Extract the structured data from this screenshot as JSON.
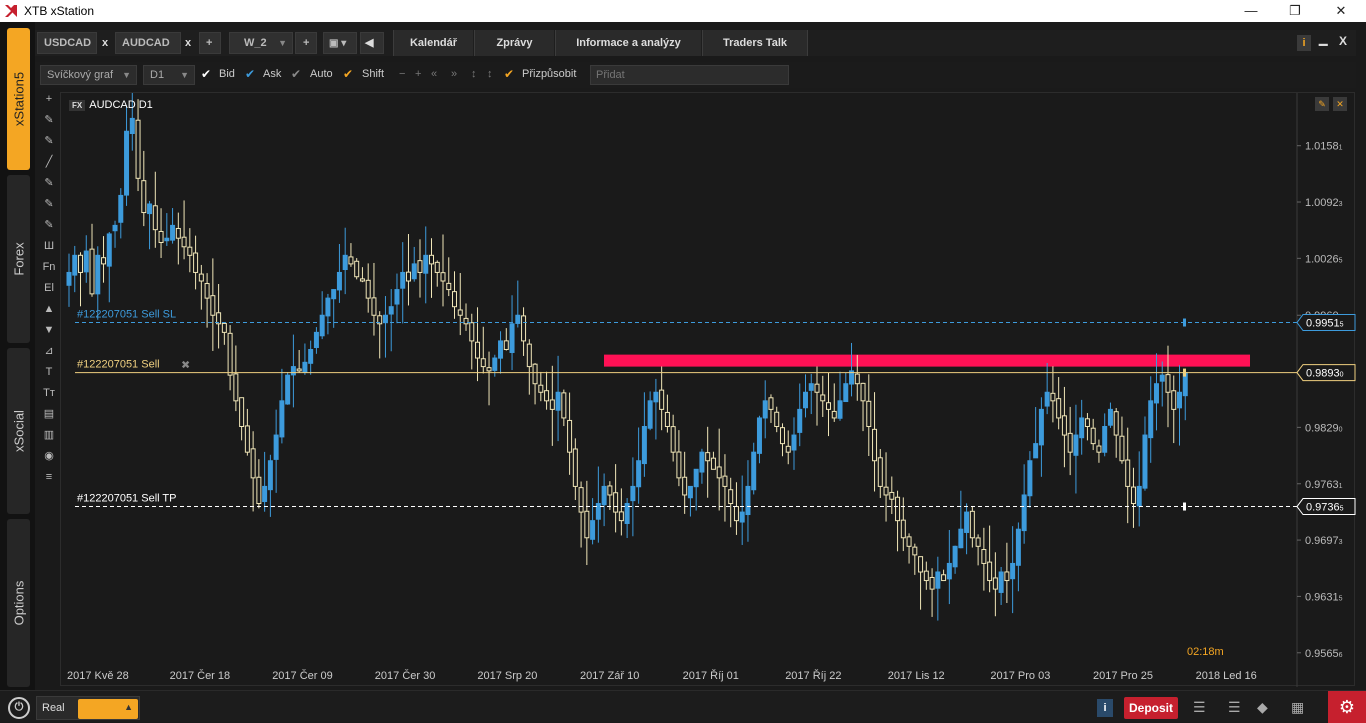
{
  "window": {
    "title": "XTB xStation",
    "minimize": "—",
    "maximize": "❐",
    "close": "✕"
  },
  "sidebar": {
    "tabs": [
      {
        "label": "xStation5",
        "active": true
      },
      {
        "label": "Forex",
        "active": false
      },
      {
        "label": "xSocial",
        "active": false
      },
      {
        "label": "Options",
        "active": false
      }
    ]
  },
  "instrument_tabs": [
    {
      "label": "USDCAD",
      "close": "x"
    },
    {
      "label": "AUDCAD",
      "close": "x"
    }
  ],
  "add_tab": "+",
  "workspace": {
    "label": "W_2",
    "add": "+"
  },
  "menu_tabs": [
    "Kalendář",
    "Zprávy",
    "Informace a analýzy",
    "Traders Talk"
  ],
  "chart_toolbar": {
    "chart_type": "Svíčkový graf",
    "timeframe": "D1",
    "bid": "Bid",
    "ask": "Ask",
    "auto": "Auto",
    "shift": "Shift",
    "customize": "Přizpůsobit",
    "add_placeholder": "Přidat"
  },
  "draw_tools": [
    "+",
    "✎",
    "✎",
    "╱",
    "✎",
    "✎",
    "✎",
    "Ш",
    "Fn",
    "El",
    "▲",
    "▼",
    "⊿",
    "T",
    "Tт",
    "▤",
    "▥",
    "◉",
    "≡"
  ],
  "chart": {
    "symbol": "AUDCAD D1",
    "symbol_tag": "FX",
    "countdown": "02:18m",
    "levels": {
      "sl": {
        "label": "#122207051 Sell  SL",
        "price": "0.9951",
        "price_suffix": "5",
        "value": 0.99515,
        "color": "#3d9bdc"
      },
      "entry": {
        "label": "#122207051 Sell",
        "price": "0.9893",
        "price_suffix": "0",
        "value": 0.9893,
        "color": "#f0d080"
      },
      "tp": {
        "label": "#122207051 Sell  TP",
        "price": "0.9736",
        "price_suffix": "5",
        "value": 0.97365,
        "color": "#ffffff"
      }
    },
    "close_x": "✖"
  },
  "chart_data": {
    "type": "candlestick",
    "title": "AUDCAD D1",
    "y_ticks": [
      {
        "label": "1.0158",
        "suffix": "1",
        "value": 1.01581
      },
      {
        "label": "1.0092",
        "suffix": "3",
        "value": 1.00923
      },
      {
        "label": "1.0026",
        "suffix": "5",
        "value": 1.00265
      },
      {
        "label": "0.9960",
        "suffix": "",
        "value": 0.996
      },
      {
        "label": "0.9829",
        "suffix": "0",
        "value": 0.9829
      },
      {
        "label": "0.9763",
        "suffix": "1",
        "value": 0.97631
      },
      {
        "label": "0.9697",
        "suffix": "3",
        "value": 0.96973
      },
      {
        "label": "0.9631",
        "suffix": "5",
        "value": 0.96315
      },
      {
        "label": "0.9565",
        "suffix": "6",
        "value": 0.95656
      }
    ],
    "x_ticks": [
      "2017 Kvě 28",
      "2017 Čer 18",
      "2017 Čer 09",
      "2017 Čer 30",
      "2017 Srp 20",
      "2017 Zář 10",
      "2017 Říj 01",
      "2017 Říj 22",
      "2017 Lis 12",
      "2017 Pro 03",
      "2017 Pro 25",
      "2018 Led 16"
    ],
    "ylim": [
      0.9556,
      1.0208
    ],
    "resistance_zone": [
      0.99,
      0.9914
    ],
    "closes": [
      1.001,
      1.003,
      1.001,
      1.0035,
      0.9985,
      1.003,
      1.002,
      1.0055,
      1.0065,
      1.01,
      1.0175,
      1.019,
      1.012,
      1.008,
      1.009,
      1.006,
      1.0045,
      1.005,
      1.0065,
      1.005,
      1.004,
      1.003,
      1.001,
      1.0,
      0.998,
      0.996,
      0.995,
      0.994,
      0.989,
      0.986,
      0.983,
      0.98,
      0.977,
      0.974,
      0.976,
      0.979,
      0.982,
      0.986,
      0.989,
      0.99,
      0.9895,
      0.9905,
      0.992,
      0.994,
      0.996,
      0.998,
      0.999,
      1.001,
      1.003,
      1.002,
      1.0005,
      1.0,
      0.998,
      0.996,
      0.995,
      0.996,
      0.997,
      0.999,
      1.001,
      1.0,
      1.002,
      1.001,
      1.003,
      1.002,
      1.001,
      1.0,
      0.999,
      0.997,
      0.996,
      0.995,
      0.993,
      0.991,
      0.99,
      0.9895,
      0.991,
      0.993,
      0.992,
      0.995,
      0.996,
      0.993,
      0.99,
      0.988,
      0.987,
      0.986,
      0.985,
      0.987,
      0.984,
      0.98,
      0.976,
      0.973,
      0.97,
      0.972,
      0.974,
      0.976,
      0.975,
      0.973,
      0.972,
      0.974,
      0.976,
      0.979,
      0.983,
      0.986,
      0.987,
      0.985,
      0.983,
      0.98,
      0.977,
      0.975,
      0.976,
      0.978,
      0.98,
      0.979,
      0.978,
      0.977,
      0.976,
      0.974,
      0.972,
      0.973,
      0.976,
      0.98,
      0.984,
      0.986,
      0.985,
      0.983,
      0.981,
      0.98,
      0.982,
      0.985,
      0.987,
      0.988,
      0.987,
      0.986,
      0.985,
      0.984,
      0.986,
      0.988,
      0.9895,
      0.988,
      0.986,
      0.983,
      0.979,
      0.976,
      0.975,
      0.9745,
      0.972,
      0.97,
      0.969,
      0.968,
      0.966,
      0.965,
      0.964,
      0.966,
      0.965,
      0.967,
      0.969,
      0.971,
      0.973,
      0.97,
      0.969,
      0.967,
      0.965,
      0.964,
      0.966,
      0.965,
      0.967,
      0.971,
      0.975,
      0.979,
      0.981,
      0.985,
      0.987,
      0.986,
      0.984,
      0.982,
      0.98,
      0.982,
      0.984,
      0.983,
      0.981,
      0.98,
      0.983,
      0.985,
      0.982,
      0.979,
      0.976,
      0.974,
      0.976,
      0.982,
      0.986,
      0.988,
      0.989,
      0.987,
      0.985,
      0.987,
      0.9893
    ]
  },
  "bottom": {
    "account_mode": "Real",
    "info_icon": "i",
    "deposit": "Deposit",
    "settings_icon": "gear-icon"
  }
}
